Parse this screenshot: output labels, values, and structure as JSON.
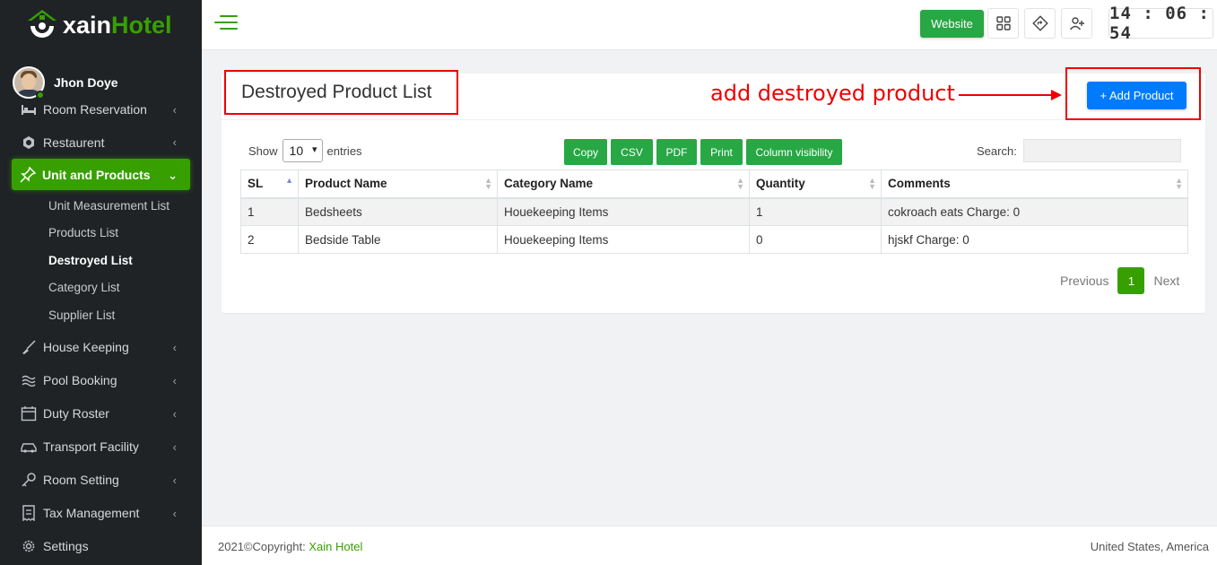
{
  "brand": {
    "name_part1": "xain",
    "name_part2": "Hotel"
  },
  "user": {
    "name": "Jhon Doye"
  },
  "sidebar": {
    "items": [
      {
        "label": "Room Reservation",
        "icon": "bed-icon",
        "chevron": "‹"
      },
      {
        "label": "Restaurent",
        "icon": "restaurant-icon",
        "chevron": "‹"
      },
      {
        "label": "Unit and Products",
        "icon": "pin-icon",
        "chevron": "⌄"
      },
      {
        "label": "House Keeping",
        "icon": "broom-icon",
        "chevron": "‹"
      },
      {
        "label": "Pool Booking",
        "icon": "waves-icon",
        "chevron": "‹"
      },
      {
        "label": "Duty Roster",
        "icon": "calendar-icon",
        "chevron": "‹"
      },
      {
        "label": "Transport Facility",
        "icon": "car-icon",
        "chevron": "‹"
      },
      {
        "label": "Room Setting",
        "icon": "key-icon",
        "chevron": "‹"
      },
      {
        "label": "Tax Management",
        "icon": "receipt-icon",
        "chevron": "‹"
      },
      {
        "label": "Settings",
        "icon": "gear-icon"
      }
    ],
    "submenu": [
      {
        "label": "Unit Measurement List"
      },
      {
        "label": "Products List"
      },
      {
        "label": "Destroyed List"
      },
      {
        "label": "Category List"
      },
      {
        "label": "Supplier List"
      }
    ]
  },
  "topbar": {
    "website_label": "Website",
    "clock": "14 : 06 : 54"
  },
  "page": {
    "title": "Destroyed Product List",
    "annotation": "add destroyed product",
    "add_button": "+ Add Product"
  },
  "table_controls": {
    "show_label": "Show",
    "entries_value": "10",
    "entries_label": "entries",
    "buttons": [
      "Copy",
      "CSV",
      "PDF",
      "Print",
      "Column visibility"
    ],
    "search_label": "Search:"
  },
  "table": {
    "headers": [
      "SL",
      "Product Name",
      "Category Name",
      "Quantity",
      "Comments"
    ],
    "rows": [
      [
        "1",
        "Bedsheets",
        "Houekeeping Items",
        "1",
        "cokroach eats Charge: 0"
      ],
      [
        "2",
        "Bedside Table",
        "Houekeeping Items",
        "0",
        "hjskf Charge: 0"
      ]
    ]
  },
  "pagination": {
    "previous": "Previous",
    "page": "1",
    "next": "Next"
  },
  "footer": {
    "copyright": "2021©Copyright: ",
    "brand": "Xain Hotel",
    "region": "United States, America"
  },
  "colors": {
    "accent": "#37a000",
    "primary": "#007bff",
    "annotation": "#ee0000",
    "sidebar_bg": "#1f2326"
  }
}
